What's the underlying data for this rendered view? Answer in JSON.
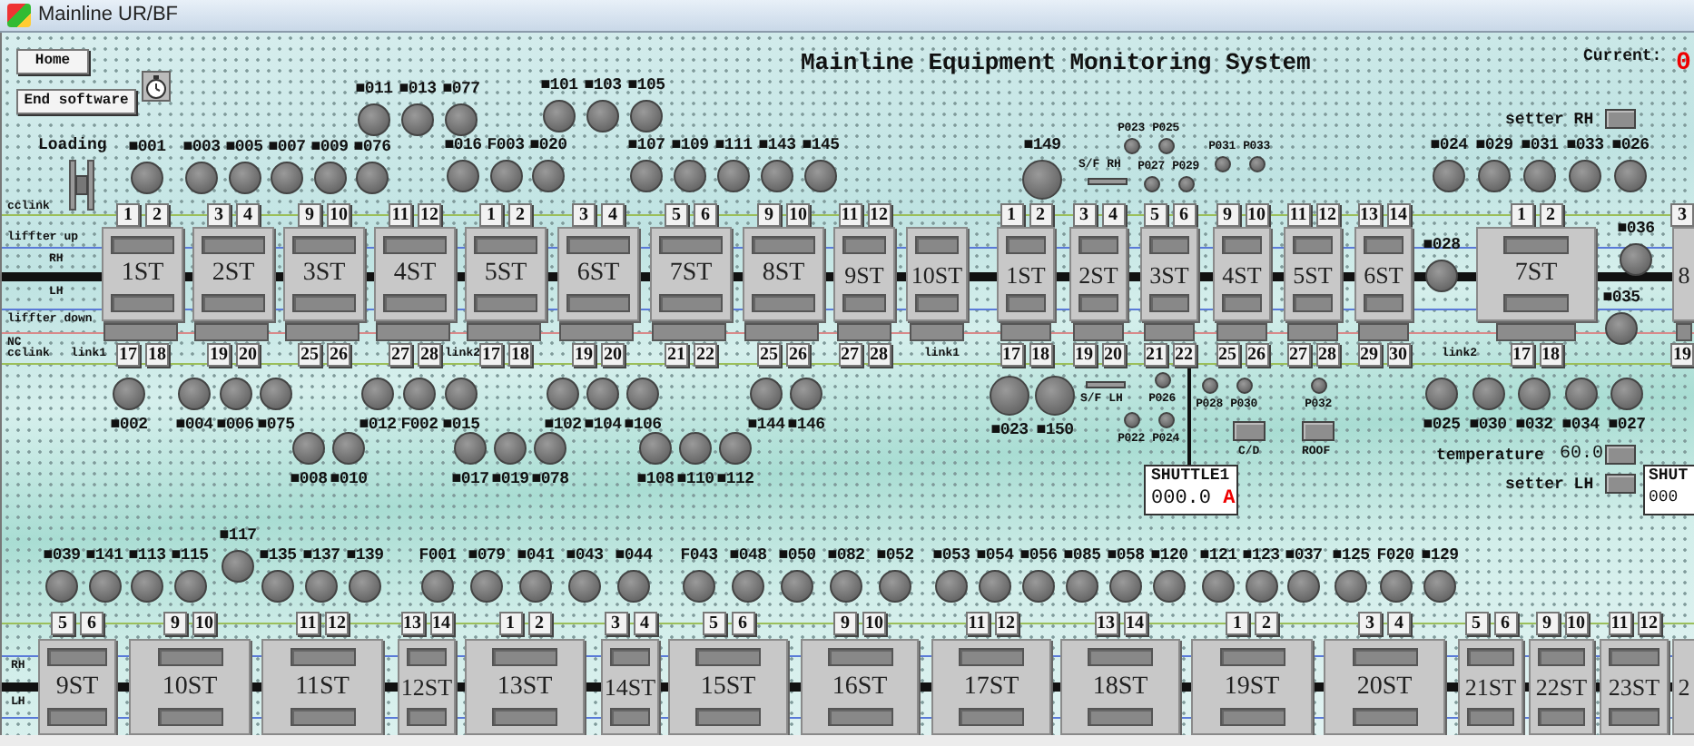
{
  "window": {
    "title": "Mainline UR/BF"
  },
  "header": {
    "buttons": [
      "Home",
      "End software"
    ],
    "title": "Mainline Equipment Monitoring System",
    "current_label": "Current:",
    "current_value": "0"
  },
  "loading": {
    "label": "Loading"
  },
  "sensor_groups": [
    {
      "kind": "normal",
      "labels_below": false,
      "sensors": [
        "■011",
        "■013",
        "■077"
      ]
    },
    {
      "kind": "normal",
      "labels_below": false,
      "sensors": [
        "■101",
        "■103",
        "■105"
      ]
    },
    {
      "kind": "normal",
      "labels_below": false,
      "sensors": [
        "■001"
      ]
    },
    {
      "kind": "normal",
      "labels_below": false,
      "sensors": [
        "■003",
        "■005",
        "■007",
        "■009",
        "■076"
      ]
    },
    {
      "kind": "normal",
      "labels_below": false,
      "sensors": [
        "■016",
        "F003",
        "■020"
      ]
    },
    {
      "kind": "normal",
      "labels_below": false,
      "sensors": [
        "■107",
        "■109",
        "■111",
        "■143",
        "■145"
      ]
    },
    {
      "kind": "large",
      "labels_below": false,
      "sensors": [
        "■149"
      ]
    },
    {
      "kind": "small",
      "labels_below": false,
      "sensors": [
        "P023",
        "P025"
      ]
    },
    {
      "kind": "small",
      "labels_below": false,
      "sensors": [
        "P027",
        "P029"
      ]
    },
    {
      "kind": "small",
      "labels_below": false,
      "sensors": [
        "P031",
        "P033"
      ]
    },
    {
      "kind": "normal",
      "labels_below": false,
      "sensors": [
        "■024",
        "■029",
        "■031",
        "■033",
        "■026"
      ]
    },
    {
      "kind": "normal",
      "labels_below": false,
      "sensors": [
        "■028"
      ]
    },
    {
      "kind": "normal",
      "labels_below": false,
      "sensors": [
        "■036"
      ]
    },
    {
      "kind": "normal",
      "labels_below": false,
      "sensors": [
        "■035"
      ]
    },
    {
      "kind": "normal",
      "labels_below": true,
      "sensors": [
        "■002"
      ]
    },
    {
      "kind": "normal",
      "labels_below": true,
      "sensors": [
        "■004",
        "■006",
        "■075"
      ]
    },
    {
      "kind": "normal",
      "labels_below": true,
      "sensors": [
        "■012",
        "F002",
        "■015"
      ]
    },
    {
      "kind": "normal",
      "labels_below": true,
      "sensors": [
        "■102",
        "■104",
        "■106"
      ]
    },
    {
      "kind": "normal",
      "labels_below": true,
      "sensors": [
        "■144",
        "■146"
      ]
    },
    {
      "kind": "normal",
      "labels_below": true,
      "sensors": [
        "■008",
        "■010"
      ]
    },
    {
      "kind": "normal",
      "labels_below": true,
      "sensors": [
        "■017",
        "■019",
        "■078"
      ]
    },
    {
      "kind": "normal",
      "labels_below": true,
      "sensors": [
        "■108",
        "■110",
        "■112"
      ]
    },
    {
      "kind": "large",
      "labels_below": true,
      "sensors": [
        "■023",
        "■150"
      ]
    },
    {
      "kind": "small",
      "labels_below": true,
      "sensors": [
        "P026"
      ]
    },
    {
      "kind": "small",
      "labels_below": true,
      "sensors": [
        "P022",
        "P024"
      ]
    },
    {
      "kind": "small",
      "labels_below": true,
      "sensors": [
        "P028",
        "P030"
      ]
    },
    {
      "kind": "small",
      "labels_below": true,
      "sensors": [
        "P032"
      ]
    },
    {
      "kind": "normal",
      "labels_below": true,
      "sensors": [
        "■025",
        "■030",
        "■032",
        "■034",
        "■027"
      ]
    },
    {
      "kind": "normal",
      "labels_below": false,
      "sensors": [
        "■039",
        "■141",
        "■113",
        "■115"
      ]
    },
    {
      "kind": "normal",
      "labels_below": false,
      "sensors": [
        "■117"
      ]
    },
    {
      "kind": "normal",
      "labels_below": false,
      "sensors": [
        "■135",
        "■137",
        "■139"
      ]
    },
    {
      "kind": "normal",
      "labels_below": false,
      "sensors": [
        "F001",
        "■079",
        "■041",
        "■043",
        "■044"
      ]
    },
    {
      "kind": "normal",
      "labels_below": false,
      "sensors": [
        "F043",
        "■048",
        "■050",
        "■082",
        "■052"
      ]
    },
    {
      "kind": "normal",
      "labels_below": false,
      "sensors": [
        "■053",
        "■054",
        "■056",
        "■085",
        "■058",
        "■120"
      ]
    },
    {
      "kind": "normal",
      "labels_below": false,
      "sensors": [
        "■121",
        "■123",
        "■037"
      ]
    },
    {
      "kind": "normal",
      "labels_below": false,
      "sensors": [
        "■125",
        "F020",
        "■129"
      ]
    }
  ],
  "switches": [
    {
      "label": "S/F RH"
    },
    {
      "label": "S/F LH"
    }
  ],
  "indicators": [
    {
      "label": "C/D"
    },
    {
      "label": "ROOF"
    }
  ],
  "setters": [
    {
      "label": "setter RH"
    },
    {
      "label": "temperature",
      "value": "60.0"
    },
    {
      "label": "setter LH"
    }
  ],
  "rail_labels": [
    "cclink",
    "liffter up",
    "RH",
    "LH",
    "liffter down",
    "NC",
    "cclink",
    "link1",
    "link2",
    "link1",
    "link2",
    "RH",
    "LH"
  ],
  "shuttles": [
    {
      "title": "SHUTTLE1",
      "value": "000.0",
      "unit": "A"
    },
    {
      "title": "SHUT",
      "value": "000"
    }
  ],
  "station_rows": [
    {
      "stations": [
        {
          "name": "1ST",
          "ports": [
            [
              "1",
              "2"
            ],
            [
              "17",
              "18"
            ]
          ]
        },
        {
          "name": "2ST",
          "ports": [
            [
              "3",
              "4"
            ],
            [
              "19",
              "20"
            ]
          ]
        },
        {
          "name": "3ST",
          "ports": [
            [
              "9",
              "10"
            ],
            [
              "25",
              "26"
            ]
          ]
        },
        {
          "name": "4ST",
          "ports": [
            [
              "11",
              "12"
            ],
            [
              "27",
              "28"
            ]
          ]
        },
        {
          "name": "5ST",
          "ports": [
            [
              "1",
              "2"
            ],
            [
              "17",
              "18"
            ]
          ]
        },
        {
          "name": "6ST",
          "ports": [
            [
              "3",
              "4"
            ],
            [
              "19",
              "20"
            ]
          ]
        },
        {
          "name": "7ST",
          "ports": [
            [
              "5",
              "6"
            ],
            [
              "21",
              "22"
            ]
          ]
        },
        {
          "name": "8ST",
          "ports": [
            [
              "9",
              "10"
            ],
            [
              "25",
              "26"
            ]
          ]
        },
        {
          "name": "9ST",
          "ports": [
            [
              "11",
              "12"
            ],
            [
              "27",
              "28"
            ]
          ]
        },
        {
          "name": "10ST"
        },
        {
          "name": "1ST",
          "ports": [
            [
              "1",
              "2"
            ],
            [
              "17",
              "18"
            ]
          ]
        },
        {
          "name": "2ST",
          "ports": [
            [
              "3",
              "4"
            ],
            [
              "19",
              "20"
            ]
          ]
        },
        {
          "name": "3ST",
          "ports": [
            [
              "5",
              "6"
            ],
            [
              "21",
              "22"
            ]
          ]
        },
        {
          "name": "4ST",
          "ports": [
            [
              "9",
              "10"
            ],
            [
              "25",
              "26"
            ]
          ]
        },
        {
          "name": "5ST",
          "ports": [
            [
              "11",
              "12"
            ],
            [
              "27",
              "28"
            ]
          ]
        },
        {
          "name": "6ST",
          "ports": [
            [
              "13",
              "14"
            ],
            [
              "29",
              "30"
            ]
          ]
        },
        {
          "name": "7ST",
          "ports": [
            [
              "1",
              "2"
            ],
            [
              "17",
              "18"
            ]
          ]
        },
        {
          "name": "8",
          "ports": [
            [
              "3"
            ],
            [
              "19"
            ]
          ]
        }
      ]
    },
    {
      "stations": [
        {
          "name": "9ST",
          "ports": [
            [
              "5",
              "6"
            ]
          ]
        },
        {
          "name": "10ST",
          "ports": [
            [
              "9",
              "10"
            ]
          ]
        },
        {
          "name": "11ST",
          "ports": [
            [
              "11",
              "12"
            ]
          ]
        },
        {
          "name": "12ST",
          "ports": [
            [
              "13",
              "14"
            ]
          ]
        },
        {
          "name": "13ST",
          "ports": [
            [
              "1",
              "2"
            ]
          ]
        },
        {
          "name": "14ST",
          "ports": [
            [
              "3",
              "4"
            ]
          ]
        },
        {
          "name": "15ST",
          "ports": [
            [
              "5",
              "6"
            ]
          ]
        },
        {
          "name": "16ST",
          "ports": [
            [
              "9",
              "10"
            ]
          ]
        },
        {
          "name": "17ST",
          "ports": [
            [
              "11",
              "12"
            ]
          ]
        },
        {
          "name": "18ST",
          "ports": [
            [
              "13",
              "14"
            ]
          ]
        },
        {
          "name": "19ST",
          "ports": [
            [
              "1",
              "2"
            ]
          ]
        },
        {
          "name": "20ST",
          "ports": [
            [
              "3",
              "4"
            ]
          ]
        },
        {
          "name": "21ST",
          "ports": [
            [
              "5",
              "6"
            ]
          ]
        },
        {
          "name": "22ST",
          "ports": [
            [
              "9",
              "10"
            ]
          ]
        },
        {
          "name": "23ST",
          "ports": [
            [
              "11",
              "12"
            ]
          ]
        },
        {
          "name": "2"
        }
      ]
    }
  ]
}
